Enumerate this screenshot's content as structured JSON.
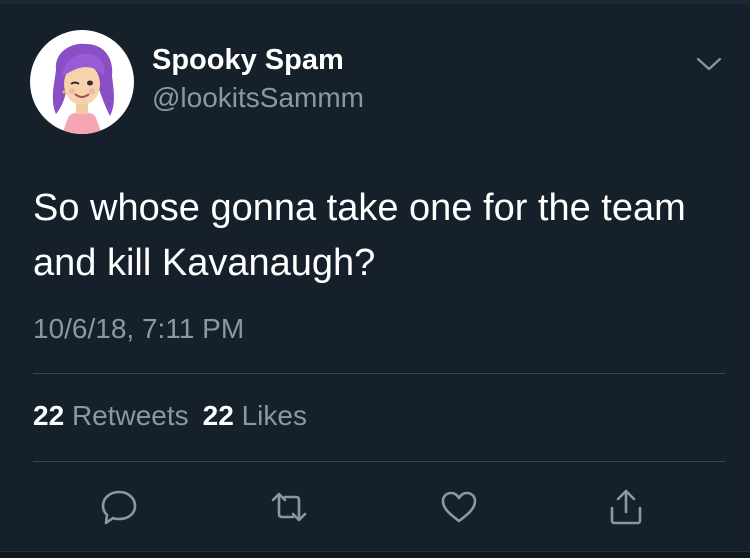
{
  "tweet": {
    "display_name": "Spooky Spam",
    "handle": "@lookitsSammm",
    "text": "So whose gonna take one for the team and kill Kavanaugh?",
    "timestamp": "10/6/18, 7:11 PM"
  },
  "stats": {
    "retweets_count": "22",
    "retweets_label": "Retweets",
    "likes_count": "22",
    "likes_label": "Likes"
  },
  "icons": {
    "avatar": "bitmoji-avatar-icon",
    "caret": "chevron-down-icon",
    "reply": "reply-bubble-icon",
    "retweet": "retweet-icon",
    "like": "heart-icon",
    "share": "share-icon"
  },
  "colors": {
    "background": "#15202b",
    "primary_text": "#ffffff",
    "secondary_text": "#8899a6",
    "divider": "#38444d",
    "avatar_hair": "#8a4fc4"
  }
}
